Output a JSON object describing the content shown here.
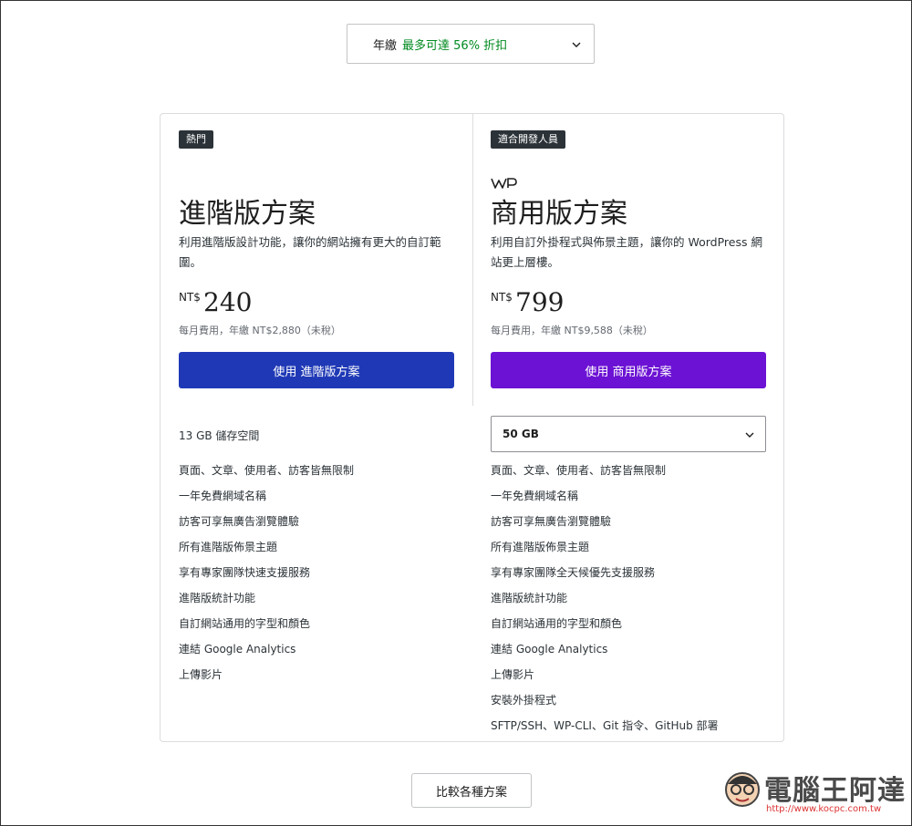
{
  "billing": {
    "label": "年繳",
    "discount": "最多可達 56% 折扣",
    "chevron_icon": "chevron-down-icon"
  },
  "plans": [
    {
      "badge": "熱門",
      "name": "進階版方案",
      "description": "利用進階版設計功能，讓你的網站擁有更大的自訂範圍。",
      "currency": "NT$",
      "price": "240",
      "price_note": "每月費用，年繳 NT$2,880（未稅）",
      "cta_label": "使用 進階版方案",
      "cta_color": "#1f39b6",
      "storage": "13 GB 儲存空間",
      "features": [
        "頁面、文章、使用者、訪客皆無限制",
        "一年免費網域名稱",
        "訪客可享無廣告瀏覽體驗",
        "所有進階版佈景主題",
        "享有專家團隊快速支援服務",
        "進階版統計功能",
        "自訂網站通用的字型和顏色",
        "連結 Google Analytics",
        "上傳影片"
      ]
    },
    {
      "badge": "適合開發人員",
      "logo_icon": "woocommerce-logo-icon",
      "name": "商用版方案",
      "description": "利用自訂外掛程式與佈景主題，讓你的 WordPress 網站更上層樓。",
      "currency": "NT$",
      "price": "799",
      "price_note": "每月費用，年繳 NT$9,588（未稅）",
      "cta_label": "使用 商用版方案",
      "cta_color": "#6c12d4",
      "storage": "50 GB",
      "features": [
        "頁面、文章、使用者、訪客皆無限制",
        "一年免費網域名稱",
        "訪客可享無廣告瀏覽體驗",
        "所有進階版佈景主題",
        "享有專家團隊全天候優先支援服務",
        "進階版統計功能",
        "自訂網站通用的字型和顏色",
        "連結 Google Analytics",
        "上傳影片",
        "安裝外掛程式",
        "SFTP/SSH、WP-CLI、Git 指令、GitHub 部署"
      ]
    }
  ],
  "compare_label": "比較各種方案",
  "watermark": {
    "text": "電腦王阿達",
    "url": "http://www.kocpc.com.tw"
  }
}
